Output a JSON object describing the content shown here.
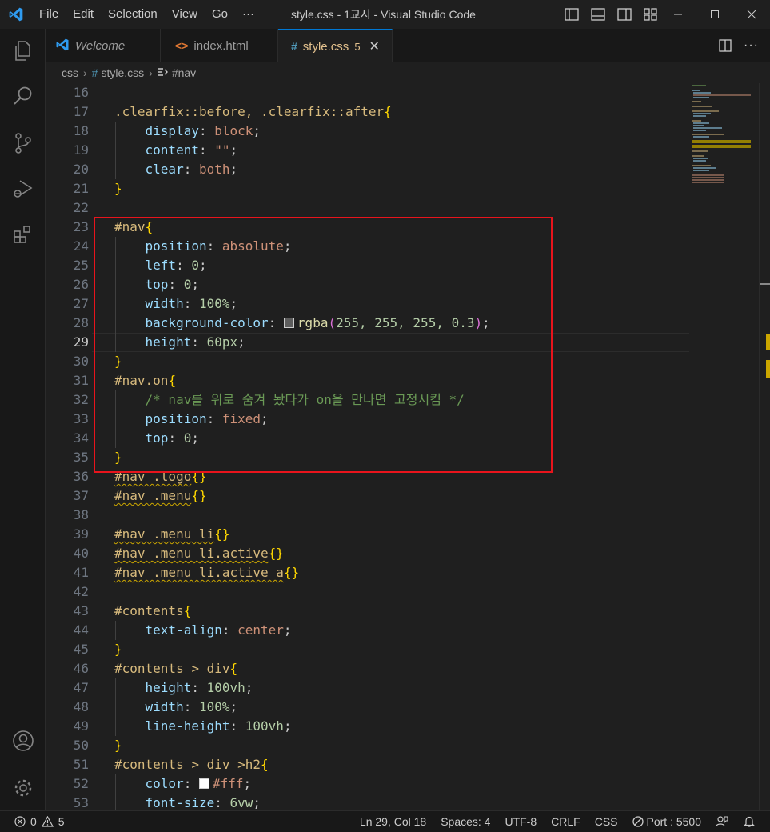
{
  "menu": [
    "File",
    "Edit",
    "Selection",
    "View",
    "Go",
    "···"
  ],
  "window_title": "style.css - 1교시 - Visual Studio Code",
  "tabs": [
    {
      "label": "Welcome",
      "icon": "vscode-icon"
    },
    {
      "label": "index.html",
      "icon": "html-icon"
    },
    {
      "label": "style.css",
      "icon": "css-hash-icon",
      "count": "5",
      "active": true
    }
  ],
  "breadcrumb": {
    "folder": "css",
    "file": "style.css",
    "symbol": "#nav"
  },
  "editor": {
    "current_line": 29,
    "lines": [
      {
        "n": "16"
      },
      {
        "n": "17"
      },
      {
        "n": "18"
      },
      {
        "n": "19"
      },
      {
        "n": "20"
      },
      {
        "n": "21"
      },
      {
        "n": "22"
      },
      {
        "n": "23"
      },
      {
        "n": "24"
      },
      {
        "n": "25"
      },
      {
        "n": "26"
      },
      {
        "n": "27"
      },
      {
        "n": "28"
      },
      {
        "n": "29"
      },
      {
        "n": "30"
      },
      {
        "n": "31"
      },
      {
        "n": "32"
      },
      {
        "n": "33"
      },
      {
        "n": "34"
      },
      {
        "n": "35"
      },
      {
        "n": "36"
      },
      {
        "n": "37"
      },
      {
        "n": "38"
      },
      {
        "n": "39"
      },
      {
        "n": "40"
      },
      {
        "n": "41"
      },
      {
        "n": "42"
      },
      {
        "n": "43"
      },
      {
        "n": "44"
      },
      {
        "n": "45"
      },
      {
        "n": "46"
      },
      {
        "n": "47"
      },
      {
        "n": "48"
      },
      {
        "n": "49"
      },
      {
        "n": "50"
      },
      {
        "n": "51"
      },
      {
        "n": "52"
      },
      {
        "n": "53"
      }
    ],
    "tokens": {
      "l17": ".clearfix::before, .clearfix::after",
      "display": "display",
      "block": "block",
      "content": "content",
      "empty": "\"\"",
      "clear": "clear",
      "both": "both",
      "nav": "#nav",
      "position": "position",
      "absolute": "absolute",
      "left": "left",
      "zero": "0",
      "top": "top",
      "width": "width",
      "pct100": "100%",
      "bgcolor": "background-color",
      "rgba": "rgba",
      "rgba_args": "255, 255, 255, 0.3",
      "height": "height",
      "px60": "60px",
      "nav_on": "#nav.on",
      "comment": "/* nav를 위로 숨겨 놨다가 on을 만나면 고정시킴 */",
      "fixed": "fixed",
      "nav_logo": "#nav .logo",
      "nav_menu": "#nav .menu",
      "nav_menu_li": "#nav .menu li",
      "nav_menu_li_active": "#nav .menu li.active",
      "nav_menu_li_active_a": "#nav .menu li.active a",
      "contents": "#contents",
      "text_align": "text-align",
      "center": "center",
      "contents_div": "#contents > div",
      "vh100": "100vh",
      "line_height": "line-height",
      "contents_div_h2": "#contents > div >h2",
      "color": "color",
      "fff": "#fff",
      "font_size": "font-size",
      "vw6": "6vw"
    }
  },
  "status": {
    "errors": "0",
    "warnings": "5",
    "position": "Ln 29, Col 18",
    "spaces": "Spaces: 4",
    "encoding": "UTF-8",
    "eol": "CRLF",
    "language": "CSS",
    "port": "Port : 5500"
  },
  "colors": {
    "accent": "#0078d4",
    "highlight_box": "#e8141c",
    "selector": "#d7ba7d",
    "property": "#9cdcfe",
    "value": "#ce9178",
    "number": "#b5cea8",
    "comment": "#6a9955"
  }
}
